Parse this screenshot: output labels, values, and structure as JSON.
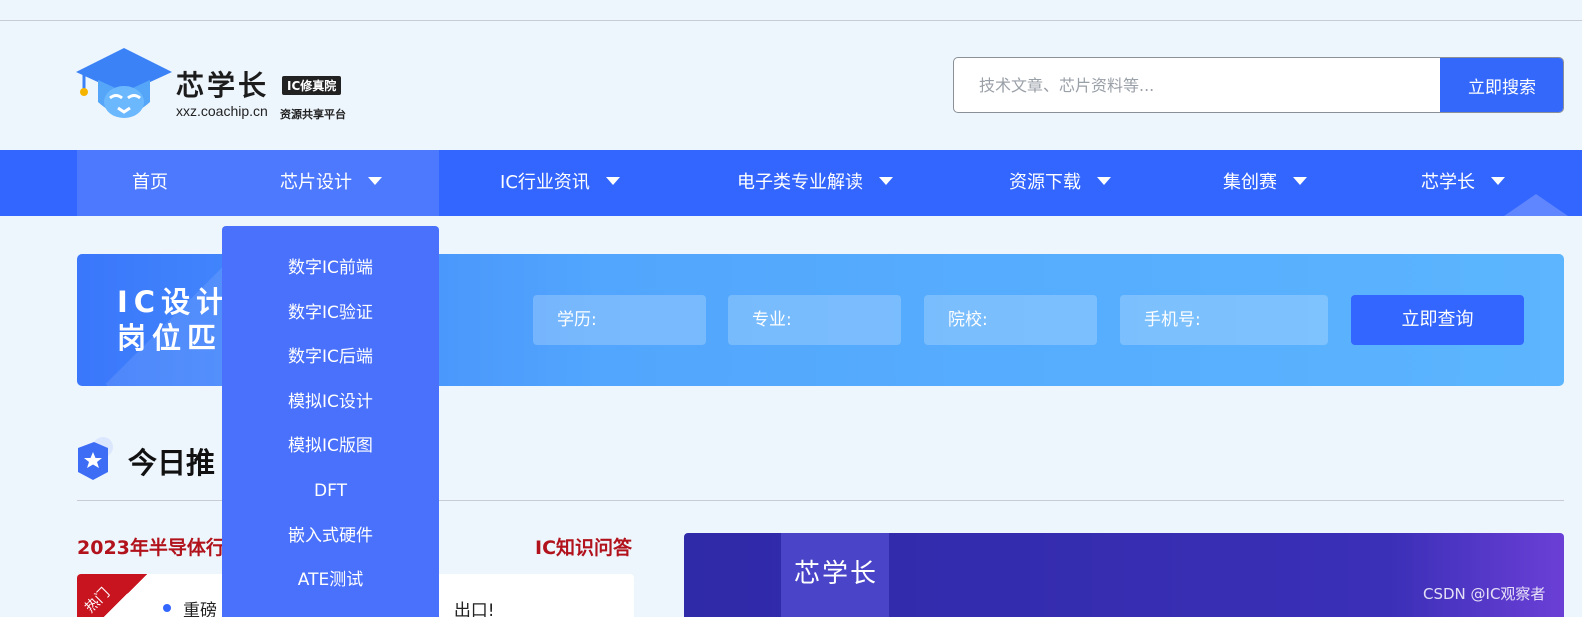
{
  "header": {
    "logo": {
      "name": "芯学长",
      "badge": "IC修真院",
      "url": "xxz.coachip.cn",
      "subtitle": "资源共享平台"
    },
    "search": {
      "placeholder": "技术文章、芯片资料等...",
      "button_label": "立即搜索"
    }
  },
  "nav": {
    "items": [
      {
        "label": "首页"
      },
      {
        "label": "芯片设计"
      },
      {
        "label": "IC行业资讯"
      },
      {
        "label": "电子类专业解读"
      },
      {
        "label": "资源下载"
      },
      {
        "label": "集创赛"
      },
      {
        "label": "芯学长"
      }
    ]
  },
  "dropdown": {
    "items": [
      "数字IC前端",
      "数字IC验证",
      "数字IC后端",
      "模拟IC设计",
      "模拟IC版图",
      "DFT",
      "嵌入式硬件",
      "ATE测试"
    ]
  },
  "banner": {
    "title_line1": "IC设计",
    "title_line2": "岗位匹西",
    "fields": {
      "education": "学历:",
      "major": "专业:",
      "school": "院校:",
      "phone": "手机号:"
    },
    "query_button": "立即查询"
  },
  "recommend": {
    "title": "今日推",
    "left_title": "2023年半导体行",
    "right_title": "IC知识问答",
    "hot_tag": "热门",
    "news_text": "重磅",
    "news_text_tail": "出口!",
    "promo_text": "芯学长"
  },
  "watermark": "CSDN @IC观察者",
  "colors": {
    "primary": "#3366ff",
    "accent_red": "#b1121b",
    "background": "#eef6fd"
  }
}
